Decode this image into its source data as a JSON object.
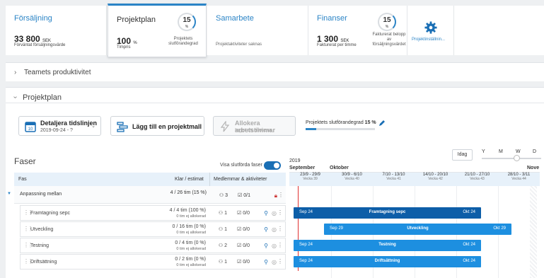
{
  "colors": {
    "accent": "#2b84c6",
    "bar_dark": "#0d5ea8",
    "bar_light": "#1d8fe0",
    "today_line": "#e03131"
  },
  "stats": {
    "sales": {
      "title": "Försäljning",
      "value": "33 800",
      "unit": "SEK",
      "caption": "Förväntat försäljningsvärde"
    },
    "plan": {
      "title": "Projektplan",
      "value": "100",
      "unit": "%",
      "caption": "Timpris",
      "ring_value": "15",
      "ring_unit": "%",
      "ring_caption": "Projektets slutförandegrad"
    },
    "collab": {
      "title": "Samarbete",
      "caption": "Projektaktiviteter saknas"
    },
    "finance": {
      "title": "Finanser",
      "value": "1 300",
      "unit": "SEK",
      "caption": "Fakturerat per timme",
      "ring_value": "15",
      "ring_unit": "%",
      "ring_caption": "Fakturerat belopp av försäljningsvärdet"
    },
    "settings": {
      "label": "Projektinställnin..."
    }
  },
  "productivity": {
    "title": "Teamets produktivitet"
  },
  "projectplan": {
    "title": "Projektplan",
    "detail_btn": {
      "label": "Detaljera tidslinjen",
      "sub": "2019-09-24 - ?"
    },
    "template_btn": {
      "label": "Lägg till en projektmall"
    },
    "allocate_btn": {
      "label": "Allokera arbetstimmar",
      "sub": "Inget att allokera"
    },
    "completion": {
      "label": "Projektets slutförandegrad",
      "value": "15 %",
      "progress": 0.15
    }
  },
  "phases": {
    "title": "Faser",
    "toggle_label": "Visa slutförda faser",
    "toggle_on": true,
    "columns": {
      "phase": "Fas",
      "done": "Klar / estimat",
      "members": "Medlemmar & aktiviteter"
    },
    "rows": [
      {
        "name": "Anpassning mellan",
        "done": "4 / 26 tim (15 %)",
        "sub": "",
        "members": "3",
        "activities": "0/1",
        "group": true
      },
      {
        "name": "Framtagning sepc",
        "done": "4 / 4 tim (100 %)",
        "sub": "0 tim ej allokerad",
        "members": "1",
        "activities": "0/0"
      },
      {
        "name": "Utveckling",
        "done": "0 / 16 tim (0 %)",
        "sub": "0 tim ej allokerad",
        "members": "1",
        "activities": "0/0"
      },
      {
        "name": "Testning",
        "done": "0 / 4 tim (0 %)",
        "sub": "0 tim ej allokerad",
        "members": "2",
        "activities": "0/0"
      },
      {
        "name": "Driftsättning",
        "done": "0 / 2 tim (0 %)",
        "sub": "0 tim ej allokerad",
        "members": "1",
        "activities": "0/0"
      }
    ]
  },
  "gantt": {
    "year": "2019",
    "today_btn": "Idag",
    "zoom": [
      "Y",
      "M",
      "W",
      "D"
    ],
    "zoom_level": "W",
    "months": [
      "September",
      "Oktober",
      "Nove"
    ],
    "weeks": [
      {
        "range": "23/9 - 29/9",
        "week": "Vecka 39"
      },
      {
        "range": "30/9 - 6/10",
        "week": "Vecka 40"
      },
      {
        "range": "7/10 - 13/10",
        "week": "Vecka 41"
      },
      {
        "range": "14/10 - 20/10",
        "week": "Vecka 42"
      },
      {
        "range": "21/10 - 27/10",
        "week": "Vecka 43"
      },
      {
        "range": "28/10 - 3/11",
        "week": "Vecka 44"
      }
    ],
    "bars": [
      {
        "name": "Framtagning sepc",
        "start": "Sep 24",
        "end": "Okt 24"
      },
      {
        "name": "Utveckling",
        "start": "Sep 29",
        "end": "Okt 29"
      },
      {
        "name": "Testning",
        "start": "Sep 24",
        "end": "Okt 24"
      },
      {
        "name": "Driftsättning",
        "start": "Sep 24",
        "end": "Okt 24"
      }
    ]
  }
}
